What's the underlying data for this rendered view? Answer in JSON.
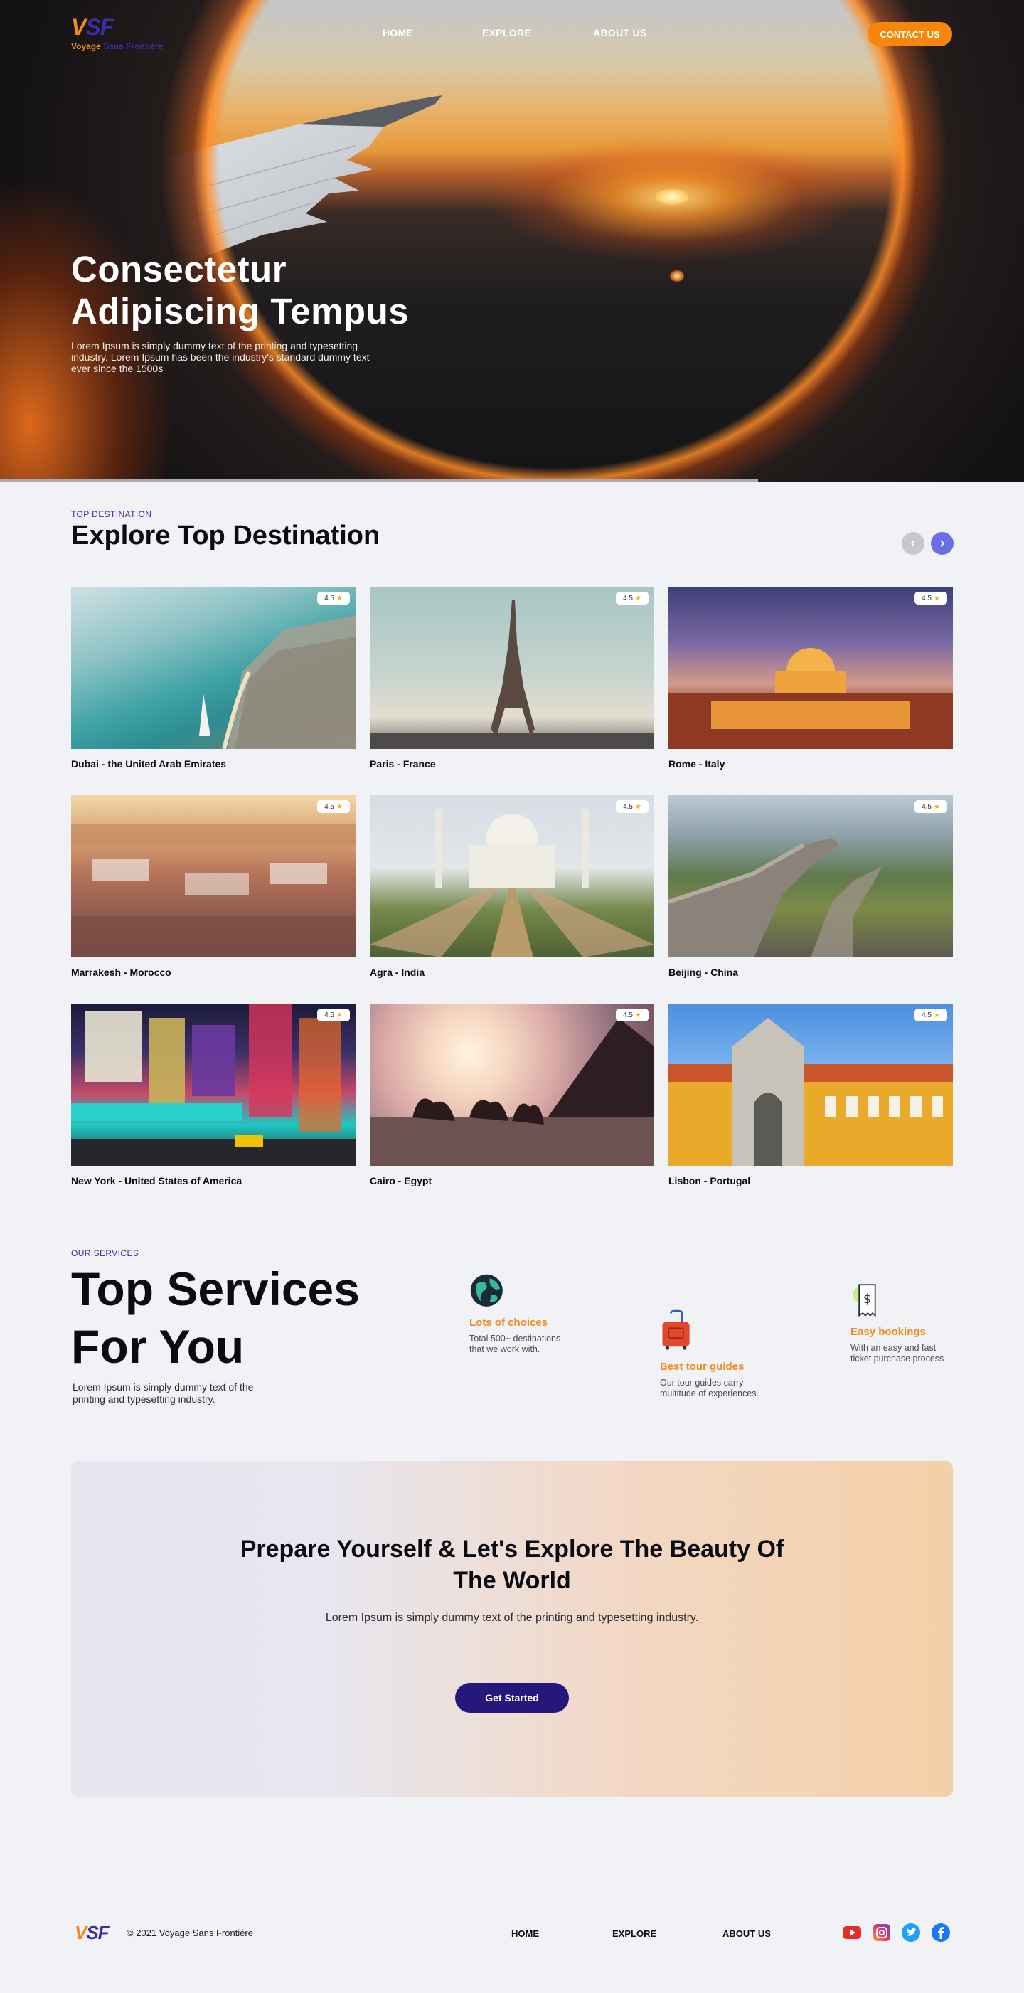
{
  "nav": {
    "logo_mark_v": "V",
    "logo_mark_sf": "SF",
    "logo_word_1": "Voyage",
    "logo_word_2": "Sans Frontiére",
    "links": [
      "HOME",
      "EXPLORE",
      "ABOUT US"
    ],
    "contact_label": "CONTACT US"
  },
  "hero": {
    "title": "Consectetur Adipiscing Tempus",
    "description": "Lorem Ipsum is simply dummy text of the printing and typesetting industry. Lorem Ipsum has been the industry's standard dummy text ever since the 1500s"
  },
  "destinations": {
    "eyebrow": "TOP DESTINATION",
    "title": "Explore Top Destination",
    "prev_icon": "chevron-left-icon",
    "next_icon": "chevron-right-icon",
    "cards": [
      {
        "name": "Dubai -  the United Arab Emirates",
        "rating": "4.5"
      },
      {
        "name": "Paris - France",
        "rating": "4.5"
      },
      {
        "name": "Rome - Italy",
        "rating": "4.5"
      },
      {
        "name": "Marrakesh - Morocco",
        "rating": "4.5"
      },
      {
        "name": "Agra - India",
        "rating": "4.5"
      },
      {
        "name": "Beijing - China",
        "rating": "4.5"
      },
      {
        "name": "New York - United States of America",
        "rating": "4.5"
      },
      {
        "name": "Cairo - Egypt",
        "rating": "4.5"
      },
      {
        "name": "Lisbon - Portugal",
        "rating": "4.5"
      }
    ]
  },
  "services": {
    "eyebrow": "OUR SERVICES",
    "title_line1": "Top Services",
    "title_line2": "For You",
    "description": "Lorem Ipsum is simply dummy text of the printing and typesetting industry.",
    "items": [
      {
        "icon": "globe-icon",
        "title": "Lots of choices",
        "text": "Total 500+ destinations that we work with."
      },
      {
        "icon": "suitcase-icon",
        "title": "Best tour guides",
        "text": "Our tour guides carry multitude of experiences."
      },
      {
        "icon": "ticket-icon",
        "title": "Easy bookings",
        "text": "With an easy and fast ticket purchase process"
      }
    ]
  },
  "cta": {
    "title": "Prepare Yourself & Let's Explore The Beauty Of The World",
    "description": "Lorem Ipsum is simply dummy text of the printing and typesetting industry.",
    "button": "Get Started"
  },
  "footer": {
    "logo_v": "V",
    "logo_sf": "SF",
    "copyright": "© 2021 Voyage Sans Frontiére",
    "links": [
      "HOME",
      "EXPLORE",
      "ABOUT US"
    ],
    "social": [
      "youtube-icon",
      "instagram-icon",
      "twitter-icon",
      "facebook-icon"
    ]
  },
  "colors": {
    "accent_orange": "#f7870a",
    "brand_indigo": "#3e2aa5",
    "button_dark": "#26177a",
    "arrow_active": "#6c6ee8"
  }
}
